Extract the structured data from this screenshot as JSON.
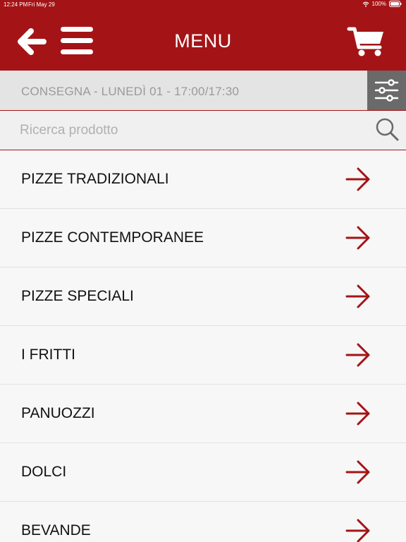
{
  "status_bar": {
    "time": "12:24 PM",
    "date": "Fri May 29",
    "battery": "100%"
  },
  "header": {
    "title": "MENU",
    "back_icon": "arrow-left-icon",
    "menu_icon": "hamburger-icon",
    "cart_icon": "cart-icon"
  },
  "delivery": {
    "text": "CONSEGNA - LUNEDÌ 01 - 17:00/17:30",
    "filter_icon": "sliders-icon"
  },
  "search": {
    "placeholder": "Ricerca prodotto",
    "value": "",
    "icon": "search-icon"
  },
  "categories": [
    {
      "label": "PIZZE TRADIZIONALI"
    },
    {
      "label": "PIZZE CONTEMPORANEE"
    },
    {
      "label": "PIZZE SPECIALI"
    },
    {
      "label": "I FRITTI"
    },
    {
      "label": "PANUOZZI"
    },
    {
      "label": "DOLCI"
    },
    {
      "label": "BEVANDE"
    }
  ],
  "colors": {
    "brand_red": "#a41416",
    "filter_button": "#6a6a6a",
    "delivery_bar": "#e4e4e4"
  }
}
